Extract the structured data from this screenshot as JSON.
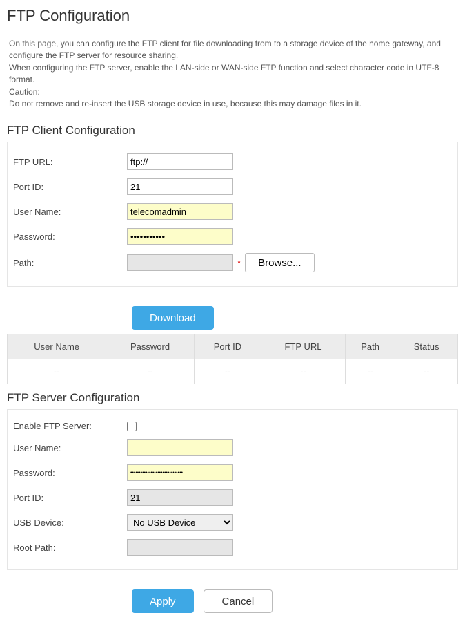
{
  "page_title": "FTP Configuration",
  "description": {
    "p1": "On this page, you can configure the FTP client for file downloading from to a storage device of the home gateway, and configure the FTP server for resource sharing.",
    "p2": "When configuring the FTP server, enable the LAN-side or WAN-side FTP function and select character code in UTF-8 format.",
    "p3": "Caution:",
    "p4": "Do not remove and re-insert the USB storage device in use, because this may damage files in it."
  },
  "client": {
    "heading": "FTP Client Configuration",
    "labels": {
      "url": "FTP URL:",
      "port": "Port ID:",
      "user": "User Name:",
      "pass": "Password:",
      "path": "Path:"
    },
    "values": {
      "url": "ftp://",
      "port": "21",
      "user": "telecomadmin",
      "pass": "•••••••••••",
      "path": ""
    },
    "asterisk": "*",
    "browse_btn": "Browse...",
    "download_btn": "Download"
  },
  "table": {
    "headers": [
      "User Name",
      "Password",
      "Port ID",
      "FTP URL",
      "Path",
      "Status"
    ],
    "row": [
      "--",
      "--",
      "--",
      "--",
      "--",
      "--"
    ]
  },
  "server": {
    "heading": "FTP Server Configuration",
    "labels": {
      "enable": "Enable FTP Server:",
      "user": "User Name:",
      "pass": "Password:",
      "port": "Port ID:",
      "usb": "USB Device:",
      "root": "Root Path:"
    },
    "values": {
      "user": "",
      "pass": "•••••••••••••••••••••••••••••••",
      "port": "21",
      "usb_selected": "No USB Device",
      "root": ""
    },
    "apply_btn": "Apply",
    "cancel_btn": "Cancel"
  }
}
